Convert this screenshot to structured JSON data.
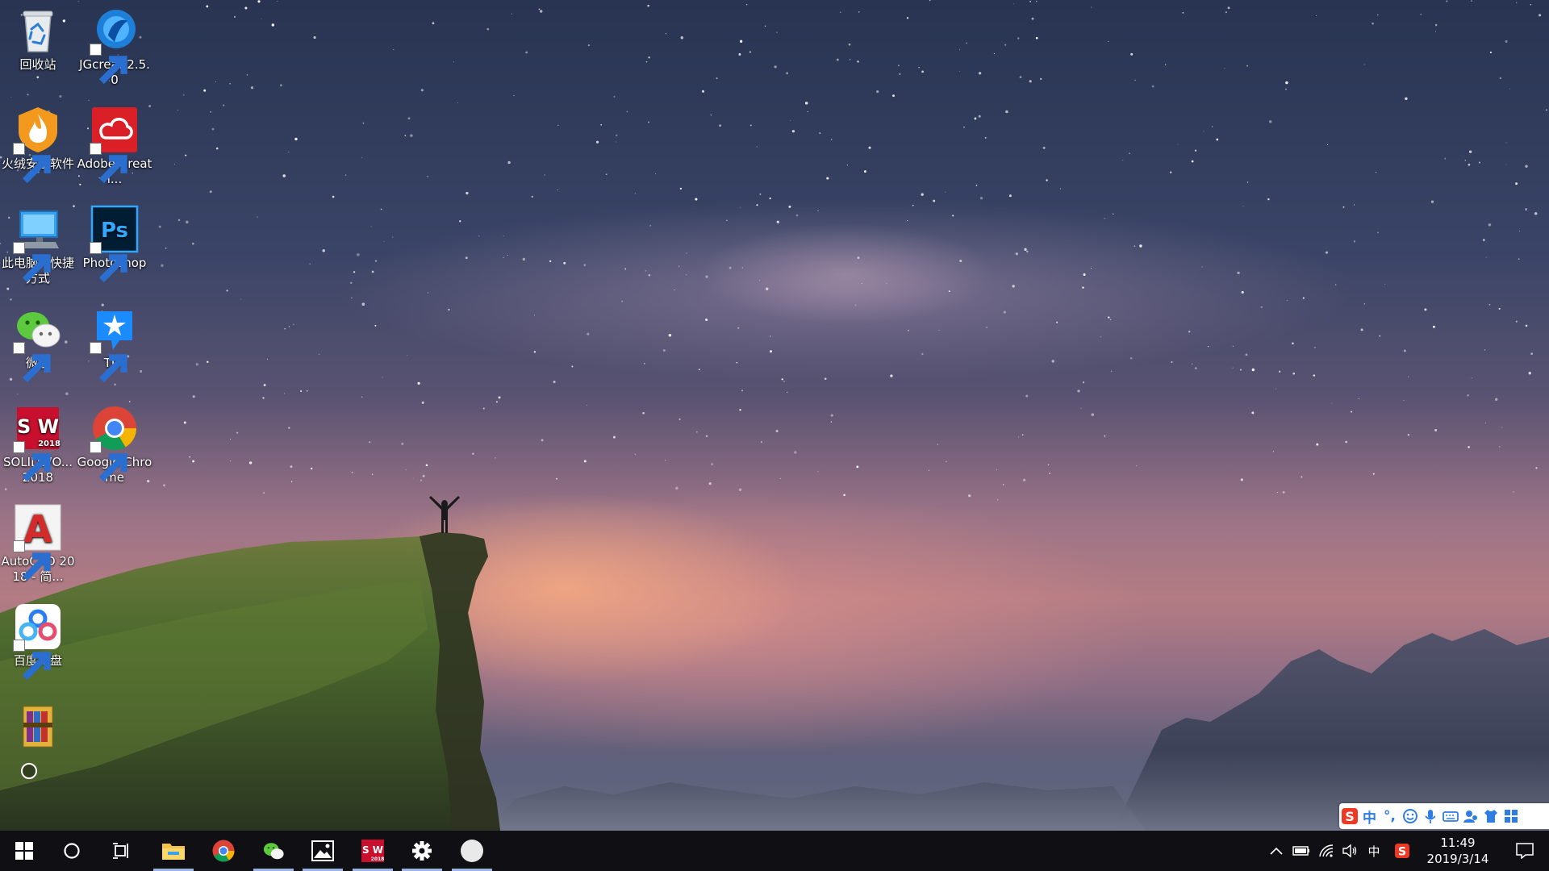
{
  "desktop": {
    "icons": [
      {
        "label": "回收站"
      },
      {
        "label": "JGcreat 2.5.0"
      },
      {
        "label": "火绒安全软件"
      },
      {
        "label": "Adobe Creati..."
      },
      {
        "label": "此电脑 - 快捷方式"
      },
      {
        "label": "Photoshop"
      },
      {
        "label": "微信"
      },
      {
        "label": "TIM"
      },
      {
        "label": "SOLIDWO... 2018"
      },
      {
        "label": "Google Chrome"
      },
      {
        "label": "AutoCAD 2018 - 简..."
      },
      {
        "label": "百度网盘"
      },
      {
        "label": ""
      }
    ],
    "icon_badges": {
      "ps": "Ps",
      "sw": "S W",
      "sw_year": "2018",
      "autocad": "A"
    }
  },
  "taskbar": {
    "start": "windows-start-icon",
    "search": "cortana-circle-icon",
    "task_view": "task-view-icon",
    "pinned": [
      {
        "name": "file-explorer-icon",
        "active": true
      },
      {
        "name": "chrome-icon",
        "active": false
      },
      {
        "name": "wechat-icon",
        "active": true
      },
      {
        "name": "photos-icon",
        "active": true
      },
      {
        "name": "solidworks-icon",
        "active": true,
        "text": "S W",
        "year": "2018"
      },
      {
        "name": "settings-gear-icon",
        "active": true
      },
      {
        "name": "white-circle-app-icon",
        "active": true
      }
    ],
    "tray": {
      "ime_mode": "中",
      "clock_time": "11:49",
      "clock_date": "2019/3/14"
    }
  },
  "ime_toolbar": {
    "logo": "S",
    "mode": "中",
    "punct": "°,"
  },
  "colors": {
    "taskbar_bg": "#101014",
    "active_indicator": "#9ab4e6",
    "ime_blue": "#2f7de1",
    "sogou_red": "#ee3a24"
  }
}
